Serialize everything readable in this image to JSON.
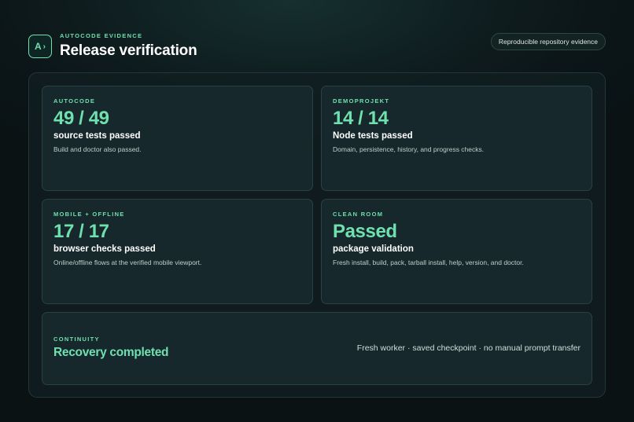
{
  "header": {
    "logo_text": "A",
    "logo_glyph": "›",
    "eyebrow": "AUTOCODE EVIDENCE",
    "title": "Release verification",
    "pill": "Reproducible repository evidence"
  },
  "cards": [
    {
      "label": "AUTOCODE",
      "value": "49 / 49",
      "subtitle": "source tests passed",
      "description": "Build and doctor also passed."
    },
    {
      "label": "DEMOPROJEKT",
      "value": "14 / 14",
      "subtitle": "Node tests passed",
      "description": "Domain, persistence, history, and progress checks."
    },
    {
      "label": "MOBILE + OFFLINE",
      "value": "17 / 17",
      "subtitle": "browser checks passed",
      "description": "Online/offline flows at the verified mobile viewport."
    },
    {
      "label": "CLEAN ROOM",
      "value": "Passed",
      "subtitle": "package validation",
      "description": "Fresh install, build, pack, tarball install, help, version, and doctor."
    }
  ],
  "continuity": {
    "label": "CONTINUITY",
    "value": "Recovery completed",
    "detail": "Fresh worker · saved checkpoint · no manual prompt transfer"
  },
  "colors": {
    "accent": "#6fe0ae",
    "background": "#0b1416",
    "card": "#16282c"
  }
}
